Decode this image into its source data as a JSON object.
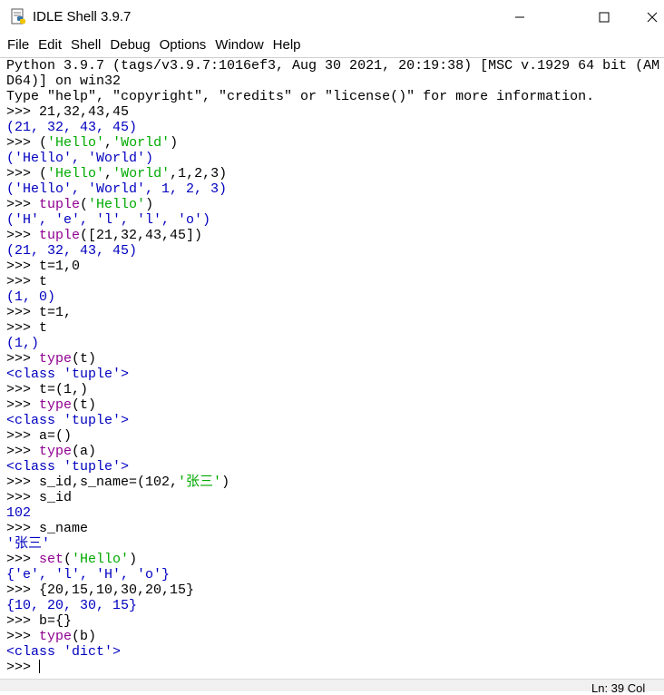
{
  "window": {
    "title": "IDLE Shell 3.9.7",
    "minimize_glyph": "—",
    "maximize_glyph": "☐",
    "close_glyph": "✕"
  },
  "menu": [
    "File",
    "Edit",
    "Shell",
    "Debug",
    "Options",
    "Window",
    "Help"
  ],
  "shell_lines": [
    [
      {
        "t": "Python 3.9.7 (tags/v3.9.7:1016ef3, Aug 30 2021, 20:19:38) [MSC v.1929 64 bit (AM",
        "c": "code"
      }
    ],
    [
      {
        "t": "D64)] on win32",
        "c": "code"
      }
    ],
    [
      {
        "t": "Type \"help\", \"copyright\", \"credits\" or \"license()\" for more information.",
        "c": "code"
      }
    ],
    [
      {
        "t": ">>> ",
        "c": "prompt"
      },
      {
        "t": "21,32,43,45",
        "c": "code"
      }
    ],
    [
      {
        "t": "(21, 32, 43, 45)",
        "c": "out"
      }
    ],
    [
      {
        "t": ">>> ",
        "c": "prompt"
      },
      {
        "t": "(",
        "c": "code"
      },
      {
        "t": "'Hello'",
        "c": "str"
      },
      {
        "t": ",",
        "c": "code"
      },
      {
        "t": "'World'",
        "c": "str"
      },
      {
        "t": ")",
        "c": "code"
      }
    ],
    [
      {
        "t": "('Hello', 'World')",
        "c": "out"
      }
    ],
    [
      {
        "t": ">>> ",
        "c": "prompt"
      },
      {
        "t": "(",
        "c": "code"
      },
      {
        "t": "'Hello'",
        "c": "str"
      },
      {
        "t": ",",
        "c": "code"
      },
      {
        "t": "'World'",
        "c": "str"
      },
      {
        "t": ",1,2,3)",
        "c": "code"
      }
    ],
    [
      {
        "t": "('Hello', 'World', 1, 2, 3)",
        "c": "out"
      }
    ],
    [
      {
        "t": ">>> ",
        "c": "prompt"
      },
      {
        "t": "tuple",
        "c": "kw"
      },
      {
        "t": "(",
        "c": "code"
      },
      {
        "t": "'Hello'",
        "c": "str"
      },
      {
        "t": ")",
        "c": "code"
      }
    ],
    [
      {
        "t": "('H', 'e', 'l', 'l', 'o')",
        "c": "out"
      }
    ],
    [
      {
        "t": ">>> ",
        "c": "prompt"
      },
      {
        "t": "tuple",
        "c": "kw"
      },
      {
        "t": "([21,32,43,45])",
        "c": "code"
      }
    ],
    [
      {
        "t": "(21, 32, 43, 45)",
        "c": "out"
      }
    ],
    [
      {
        "t": ">>> ",
        "c": "prompt"
      },
      {
        "t": "t=1,0",
        "c": "code"
      }
    ],
    [
      {
        "t": ">>> ",
        "c": "prompt"
      },
      {
        "t": "t",
        "c": "code"
      }
    ],
    [
      {
        "t": "(1, 0)",
        "c": "out"
      }
    ],
    [
      {
        "t": ">>> ",
        "c": "prompt"
      },
      {
        "t": "t=1,",
        "c": "code"
      }
    ],
    [
      {
        "t": ">>> ",
        "c": "prompt"
      },
      {
        "t": "t",
        "c": "code"
      }
    ],
    [
      {
        "t": "(1,)",
        "c": "out"
      }
    ],
    [
      {
        "t": ">>> ",
        "c": "prompt"
      },
      {
        "t": "type",
        "c": "kw"
      },
      {
        "t": "(t)",
        "c": "code"
      }
    ],
    [
      {
        "t": "<class 'tuple'>",
        "c": "out"
      }
    ],
    [
      {
        "t": ">>> ",
        "c": "prompt"
      },
      {
        "t": "t=(1,)",
        "c": "code"
      }
    ],
    [
      {
        "t": ">>> ",
        "c": "prompt"
      },
      {
        "t": "type",
        "c": "kw"
      },
      {
        "t": "(t)",
        "c": "code"
      }
    ],
    [
      {
        "t": "<class 'tuple'>",
        "c": "out"
      }
    ],
    [
      {
        "t": ">>> ",
        "c": "prompt"
      },
      {
        "t": "a=()",
        "c": "code"
      }
    ],
    [
      {
        "t": ">>> ",
        "c": "prompt"
      },
      {
        "t": "type",
        "c": "kw"
      },
      {
        "t": "(a)",
        "c": "code"
      }
    ],
    [
      {
        "t": "<class 'tuple'>",
        "c": "out"
      }
    ],
    [
      {
        "t": ">>> ",
        "c": "prompt"
      },
      {
        "t": "s_id,s_name=(102,",
        "c": "code"
      },
      {
        "t": "'张三'",
        "c": "str"
      },
      {
        "t": ")",
        "c": "code"
      }
    ],
    [
      {
        "t": ">>> ",
        "c": "prompt"
      },
      {
        "t": "s_id",
        "c": "code"
      }
    ],
    [
      {
        "t": "102",
        "c": "out"
      }
    ],
    [
      {
        "t": ">>> ",
        "c": "prompt"
      },
      {
        "t": "s_name",
        "c": "code"
      }
    ],
    [
      {
        "t": "'张三'",
        "c": "out"
      }
    ],
    [
      {
        "t": ">>> ",
        "c": "prompt"
      },
      {
        "t": "set",
        "c": "kw"
      },
      {
        "t": "(",
        "c": "code"
      },
      {
        "t": "'Hello'",
        "c": "str"
      },
      {
        "t": ")",
        "c": "code"
      }
    ],
    [
      {
        "t": "{'e', 'l', 'H', 'o'}",
        "c": "out"
      }
    ],
    [
      {
        "t": ">>> ",
        "c": "prompt"
      },
      {
        "t": "{20,15,10,30,20,15}",
        "c": "code"
      }
    ],
    [
      {
        "t": "{10, 20, 30, 15}",
        "c": "out"
      }
    ],
    [
      {
        "t": ">>> ",
        "c": "prompt"
      },
      {
        "t": "b={}",
        "c": "code"
      }
    ],
    [
      {
        "t": ">>> ",
        "c": "prompt"
      },
      {
        "t": "type",
        "c": "kw"
      },
      {
        "t": "(b)",
        "c": "code"
      }
    ],
    [
      {
        "t": "<class 'dict'>",
        "c": "out"
      }
    ],
    [
      {
        "t": ">>> ",
        "c": "prompt"
      }
    ]
  ],
  "status": {
    "text": "Ln: 39  Col"
  },
  "colors": {
    "keyword": "#900090",
    "string": "#00aa00",
    "output": "#0000c0",
    "text": "#000000"
  }
}
